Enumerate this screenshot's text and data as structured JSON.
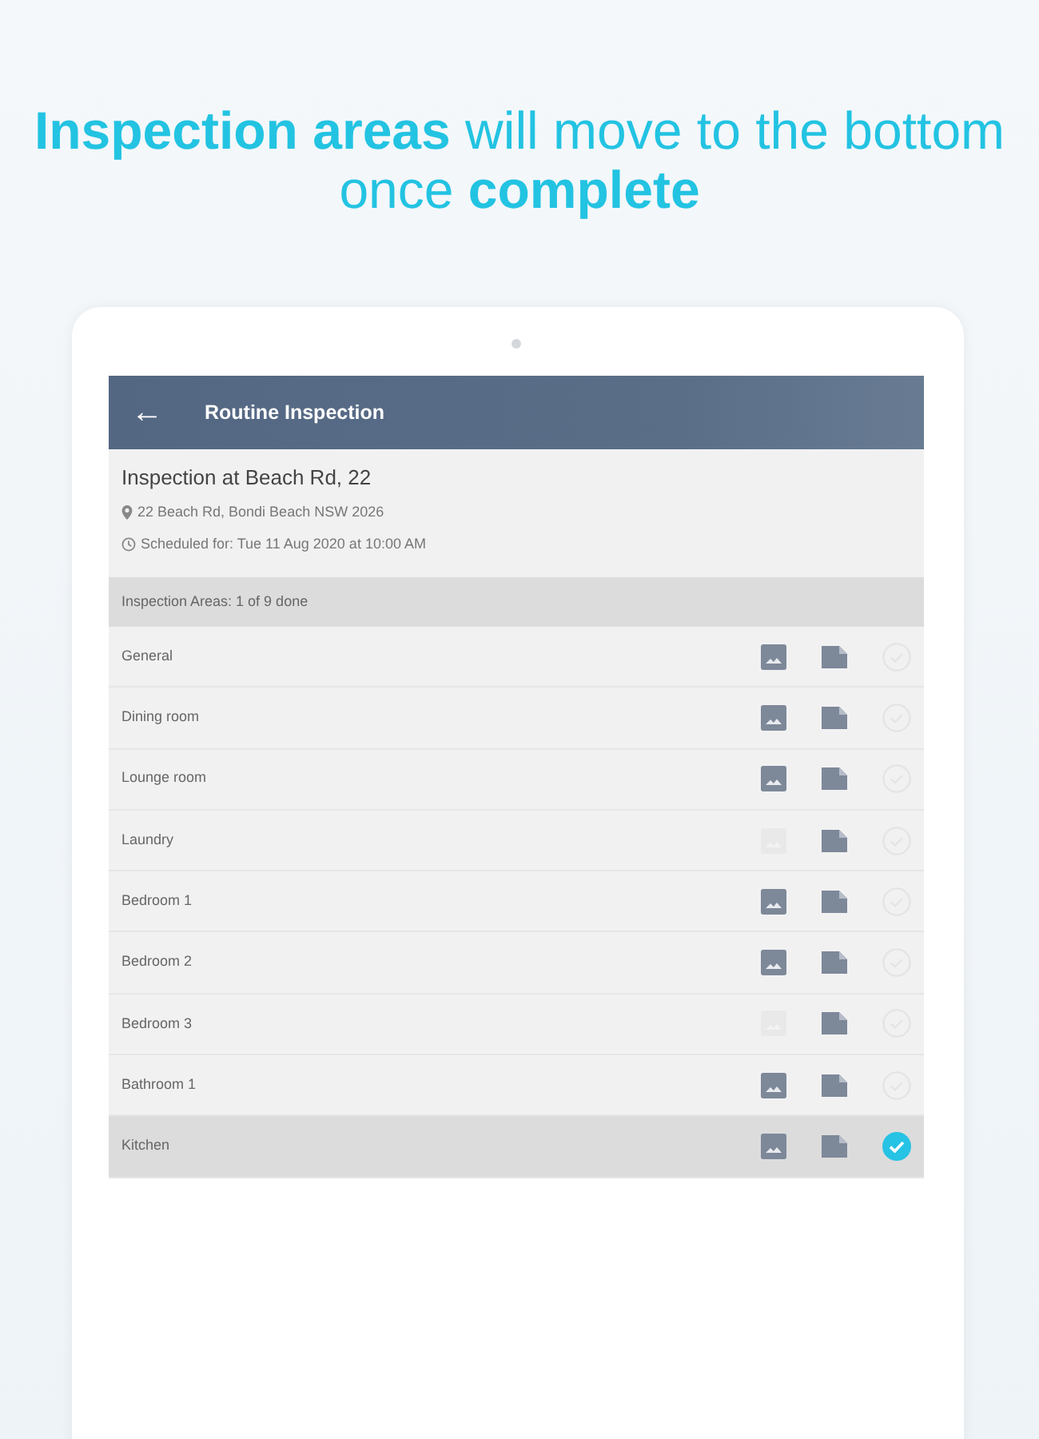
{
  "headline": "**Inspection areas** will move to the bottom once **complete**",
  "app_bar": {
    "back_icon": "←",
    "title": "Routine Inspection"
  },
  "inspection": {
    "title": "Inspection at Beach Rd, 22",
    "address": "22 Beach Rd, Bondi Beach NSW 2026",
    "scheduled": "Scheduled for: Tue 11 Aug 2020 at 10:00 AM"
  },
  "section_header": "Inspection Areas: 1 of 9 done",
  "areas": [
    {
      "name": "General",
      "photo_enabled": true,
      "complete": false
    },
    {
      "name": "Dining room",
      "photo_enabled": true,
      "complete": false
    },
    {
      "name": "Lounge room",
      "photo_enabled": true,
      "complete": false
    },
    {
      "name": "Laundry",
      "photo_enabled": false,
      "complete": false
    },
    {
      "name": "Bedroom 1",
      "photo_enabled": true,
      "complete": false
    },
    {
      "name": "Bedroom 2",
      "photo_enabled": true,
      "complete": false
    },
    {
      "name": "Bedroom 3",
      "photo_enabled": false,
      "complete": false
    },
    {
      "name": "Bathroom 1",
      "photo_enabled": true,
      "complete": false
    },
    {
      "name": "Kitchen",
      "photo_enabled": true,
      "complete": true
    }
  ]
}
